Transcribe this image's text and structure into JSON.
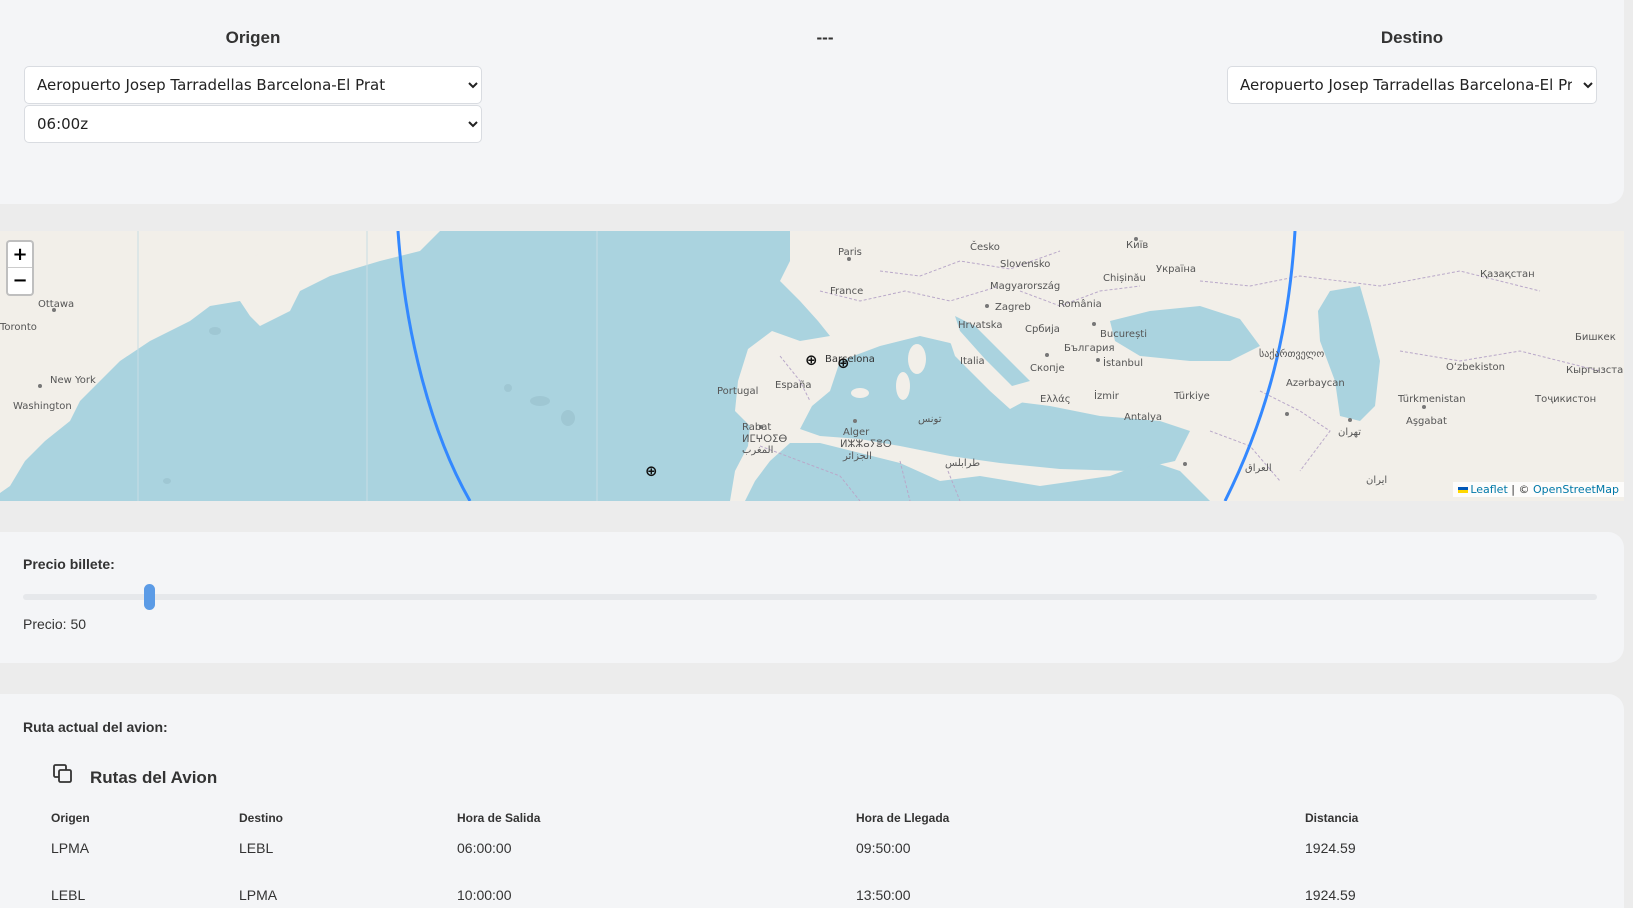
{
  "origin": {
    "title": "Origen",
    "airport_selected": "Aeropuerto Josep Tarradellas Barcelona-El Prat",
    "time_selected": "06:00z"
  },
  "separator": "---",
  "destination": {
    "title": "Destino",
    "airport_selected": "Aeropuerto Josep Tarradellas Barcelona-El Prat"
  },
  "map": {
    "zoom_in": "+",
    "zoom_out": "−",
    "attribution_leaflet": "Leaflet",
    "attribution_sep": " | © ",
    "attribution_osm": "OpenStreetMap",
    "route_color": "#3388ff",
    "labels": {
      "paris": "Paris",
      "france": "France",
      "cesko": "Česko",
      "slovensko": "Slovensko",
      "kyiv": "Київ",
      "ukraina": "Україна",
      "kazakhstan": "Қазақстан",
      "magyarorszag": "Magyarország",
      "chisinau": "Chișinău",
      "zagreb": "Zagreb",
      "romania": "România",
      "hrvatska": "Hrvatska",
      "srbija": "Србија",
      "bucuresti": "București",
      "bulgaria": "България",
      "italia": "Italia",
      "skopje": "Скопје",
      "istanbul": "İstanbul",
      "georgia": "საქართველო",
      "azerbaycan": "Azərbaycan",
      "ozbekiston": "Oʻzbekiston",
      "bishkek": "Бишкек",
      "kyrgyzstan": "Кыргызстан",
      "turkmenistan": "Türkmenistan",
      "tajikistan": "Тоҷикистон",
      "ashgabat": "Aşgabat",
      "turkiye": "Türkiye",
      "izmir": "İzmir",
      "ellas": "Ελλάς",
      "ankara": "Antalya",
      "ottawa": "Ottawa",
      "toronto": "Toronto",
      "newyork": "New York",
      "washington": "Washington",
      "portugal": "Portugal",
      "espana": "España",
      "barcelona": "Barcelona",
      "rabat": "Rabat",
      "morocco": "ⵍⵎⵖⵔⵉⴱ",
      "morocco_ar": "المغرب",
      "alger": "Alger",
      "algeria": "ⵍⵣⵣⴰⵢⴻⵔ",
      "algeria_ar": "الجزائر",
      "tunis": "تونس",
      "tripoli": "طرابلس",
      "iraq": "العراق",
      "tehran": "تهران",
      "iran": "ایران"
    }
  },
  "price": {
    "label": "Precio billete:",
    "value_text": "Precio: 50",
    "min": 0,
    "max": 650,
    "value": 50
  },
  "route": {
    "section_label": "Ruta actual del avion:",
    "icon": "copy-icon",
    "table_title": "Rutas del Avion",
    "columns": [
      "Origen",
      "Destino",
      "Hora de Salida",
      "Hora de Llegada",
      "Distancia"
    ],
    "rows": [
      [
        "LPMA",
        "LEBL",
        "06:00:00",
        "09:50:00",
        "1924.59"
      ],
      [
        "LEBL",
        "LPMA",
        "10:00:00",
        "13:50:00",
        "1924.59"
      ]
    ]
  }
}
